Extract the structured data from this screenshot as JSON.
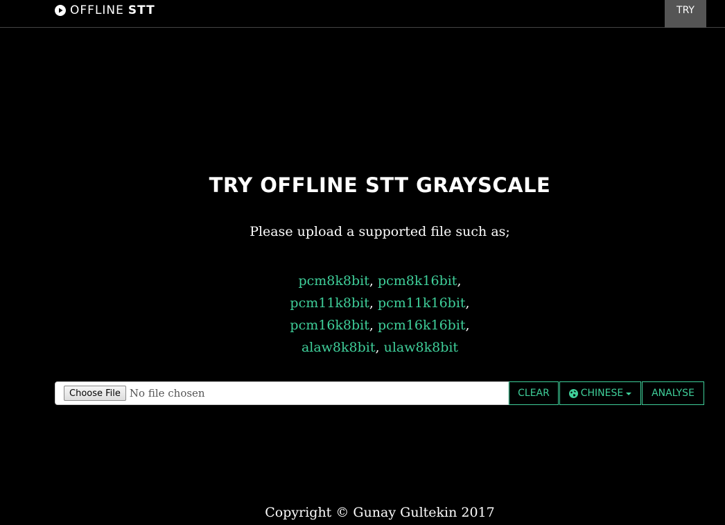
{
  "navbar": {
    "brand_light": "OFFLINE",
    "brand_bold": "STT",
    "try_label": "TRY"
  },
  "main": {
    "title": "TRY OFFLINE STT GRAYSCALE",
    "subtitle": "Please upload a supported file such as;",
    "format_rows": [
      [
        "pcm8k8bit",
        "pcm8k16bit"
      ],
      [
        "pcm11k8bit",
        "pcm11k16bit"
      ],
      [
        "pcm16k8bit",
        "pcm16k16bit"
      ],
      [
        "alaw8k8bit",
        "ulaw8k8bit"
      ]
    ]
  },
  "upload": {
    "choose_label": "Choose File",
    "no_file_text": "No file chosen",
    "clear_label": "CLEAR",
    "language_label": "CHINESE",
    "analyse_label": "ANALYSE"
  },
  "footer": {
    "copyright": "Copyright © Gunay Gultekin 2017"
  },
  "colors": {
    "accent": "#3fcf9a",
    "background": "#000000",
    "nav_active": "#555555"
  },
  "icons": {
    "brand": "play-circle-icon",
    "language": "globe-icon",
    "dropdown": "caret-down-icon"
  }
}
